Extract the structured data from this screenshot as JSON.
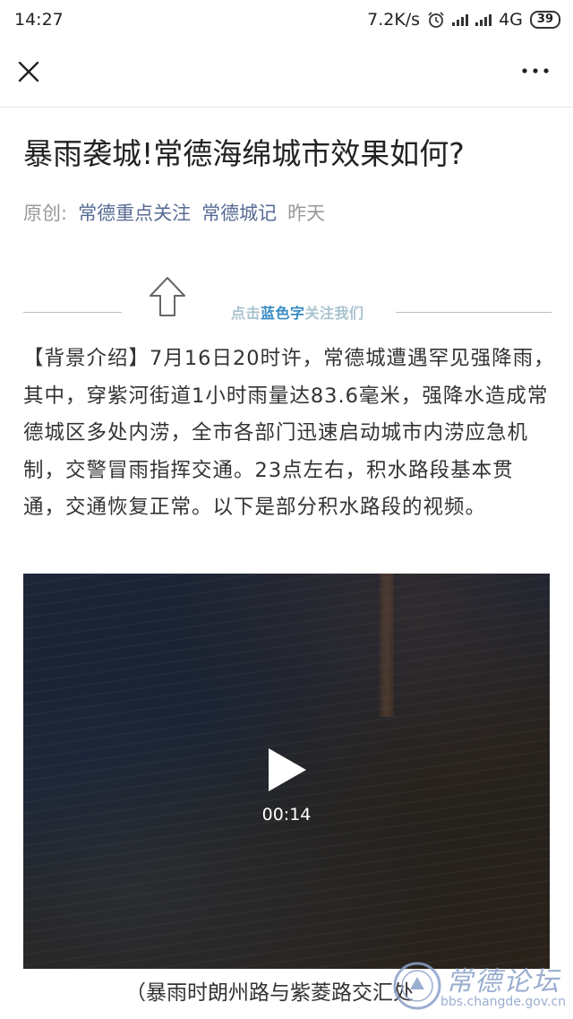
{
  "status_bar": {
    "time": "14:27",
    "net_speed": "7.2K/s",
    "network": "4G",
    "battery": "39",
    "icons": [
      "alarm-icon",
      "signal-icon",
      "signal-icon",
      "battery-icon"
    ]
  },
  "navbar": {
    "close_icon": "close-icon",
    "more_icon": "more-icon"
  },
  "article": {
    "title": "暴雨袭城!常德海绵城市效果如何?",
    "meta": {
      "prefix": "原创:",
      "author": "常德重点关注",
      "account": "常德城记",
      "date": "昨天"
    },
    "follow": {
      "pre": "点击",
      "highlight": "蓝色字",
      "post": "关注我们"
    },
    "body": "【背景介绍】7月16日20时许，常德城遭遇罕见强降雨，其中，穿紫河街道1小时雨量达83.6毫米，强降水造成常德城区多处内涝，全市各部门迅速启动城市内涝应急机制，交警冒雨指挥交通。23点左右，积水路段基本贯通，交通恢复正常。以下是部分积水路段的视频。",
    "video": {
      "duration": "00:14"
    },
    "caption": "（暴雨时朗州路与紫菱路交汇处"
  },
  "watermark": {
    "title": "常德论坛",
    "url": "bbs.changde.gov.cn"
  }
}
